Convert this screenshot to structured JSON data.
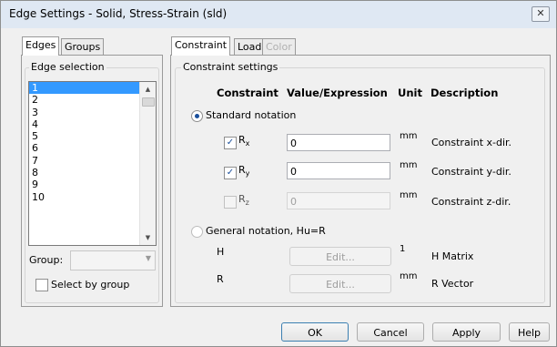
{
  "window": {
    "title": "Edge Settings - Solid, Stress-Strain (sld)",
    "close_glyph": "✕"
  },
  "left_tabs": [
    {
      "label": "Edges"
    },
    {
      "label": "Groups"
    }
  ],
  "edge_selection": {
    "legend": "Edge selection",
    "items": [
      "1",
      "2",
      "3",
      "4",
      "5",
      "6",
      "7",
      "8",
      "9",
      "10"
    ],
    "selected": "1"
  },
  "group": {
    "label": "Group:",
    "value": ""
  },
  "select_by_group": {
    "label": "Select by group",
    "checked": false
  },
  "right_tabs": [
    {
      "label": "Constraint"
    },
    {
      "label": "Load"
    },
    {
      "label": "Color"
    }
  ],
  "constraint_settings": {
    "legend": "Constraint settings",
    "headers": {
      "constraint": "Constraint",
      "value": "Value/Expression",
      "unit": "Unit",
      "description": "Description"
    },
    "standard_notation": {
      "label": "Standard notation",
      "selected": true
    },
    "rows": [
      {
        "symbol": "R",
        "sub": "x",
        "checked": true,
        "value": "0",
        "unit": "mm",
        "description": "Constraint x-dir."
      },
      {
        "symbol": "R",
        "sub": "y",
        "checked": true,
        "value": "0",
        "unit": "mm",
        "description": "Constraint y-dir."
      },
      {
        "symbol": "R",
        "sub": "z",
        "checked": false,
        "value": "0",
        "unit": "mm",
        "description": "Constraint z-dir."
      }
    ],
    "general_notation": {
      "label": "General notation, Hu=R",
      "selected": false
    },
    "matrix_rows": [
      {
        "name": "H",
        "button": "Edit...",
        "unit": "1",
        "description": "H Matrix"
      },
      {
        "name": "R",
        "button": "Edit...",
        "unit": "mm",
        "description": "R Vector"
      }
    ]
  },
  "buttons": {
    "ok": "OK",
    "cancel": "Cancel",
    "apply": "Apply",
    "help": "Help"
  },
  "check_glyph": "✓"
}
